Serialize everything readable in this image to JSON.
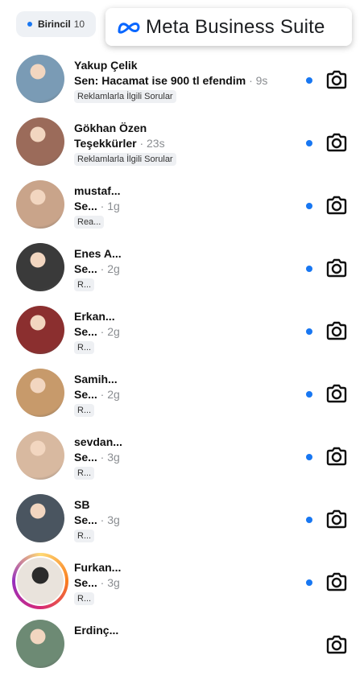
{
  "filter": {
    "label": "Birincil",
    "count": "10"
  },
  "brand": {
    "name": "Meta Business Suite",
    "color": "#0866ff"
  },
  "accent": "#1877f2",
  "conversations": [
    {
      "name": "Yakup Çelik",
      "preview": "Sen: Hacamat ise 900 tl efendim",
      "time": "· 9s",
      "tag": "Reklamlarla İlgili Sorular",
      "avatar": "#7a9bb5",
      "ring": false
    },
    {
      "name": "Gökhan Özen",
      "preview": "Teşekkürler",
      "time": "· 23s",
      "tag": "Reklamlarla İlgili Sorular",
      "avatar": "#9b6b5a",
      "ring": false
    },
    {
      "name": "mustaf...",
      "preview": "Se...",
      "time": "· 1g",
      "tag": "Rea...",
      "avatar": "#c9a48a",
      "ring": false
    },
    {
      "name": "Enes A...",
      "preview": "Se...",
      "time": "· 2g",
      "tag": "R...",
      "avatar": "#3a3a3a",
      "ring": false
    },
    {
      "name": "Erkan...",
      "preview": "Se...",
      "time": "· 2g",
      "tag": "R...",
      "avatar": "#8b2f2f",
      "ring": false
    },
    {
      "name": "Samih...",
      "preview": "Se...",
      "time": "· 2g",
      "tag": "R...",
      "avatar": "#c79a6b",
      "ring": false
    },
    {
      "name": "sevdan...",
      "preview": "Se...",
      "time": "· 3g",
      "tag": "R...",
      "avatar": "#d8b9a0",
      "ring": false
    },
    {
      "name": "SB",
      "preview": "Se...",
      "time": "· 3g",
      "tag": "R...",
      "avatar": "#4a5560",
      "ring": false
    },
    {
      "name": "Furkan...",
      "preview": "Se...",
      "time": "· 3g",
      "tag": "R...",
      "avatar": "#e9e3dc",
      "ring": true
    },
    {
      "name": "Erdinç...",
      "preview": "",
      "time": "",
      "tag": "",
      "avatar": "#6d8a74",
      "ring": false
    }
  ]
}
